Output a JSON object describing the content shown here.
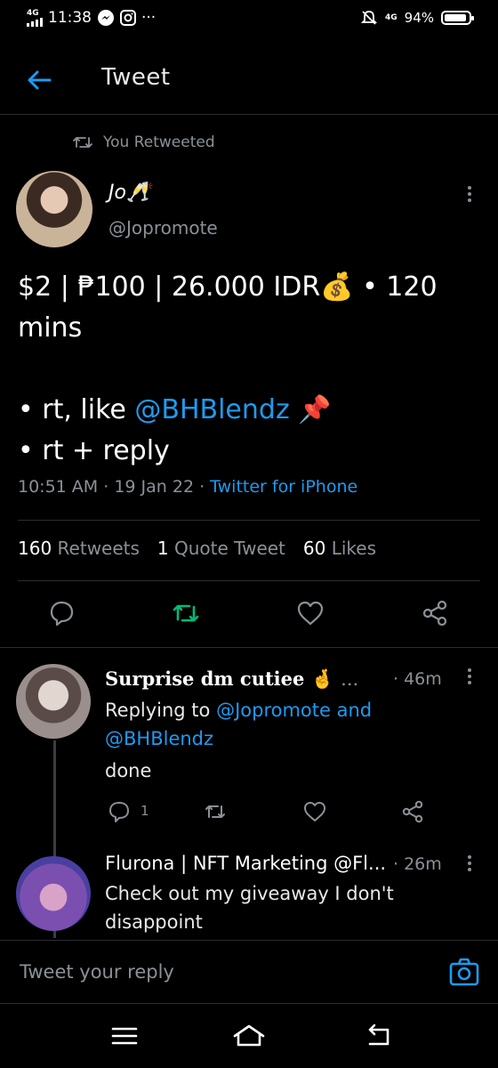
{
  "status_bar": {
    "network": "4G",
    "time": "11:38",
    "more": "···",
    "network_right": "4G",
    "battery": "94%",
    "battery_level": 0.94
  },
  "header": {
    "title": "Tweet"
  },
  "retweet_label": "You Retweeted",
  "author": {
    "name": "Jo🥂",
    "handle": "@Jopromote"
  },
  "tweet": {
    "line1": "$2 | ₱100 | 26.000 IDR💰 • 120 mins",
    "line2_prefix": "• rt, like ",
    "line2_mention": "@BHBlendz",
    "line2_suffix": " 📌",
    "line3": "• rt + reply"
  },
  "meta": {
    "time": "10:51 AM",
    "sep1": " · ",
    "date": "19 Jan 22",
    "sep2": " · ",
    "source": "Twitter for iPhone"
  },
  "stats": {
    "retweets_count": "160",
    "retweets_label": "Retweets",
    "quotes_count": "1",
    "quotes_label": "Quote Tweet",
    "likes_count": "60",
    "likes_label": "Likes"
  },
  "colors": {
    "accent": "#1d9bf0",
    "retweet_active": "#00ba7c",
    "background": "#000000",
    "muted": "#8b9197"
  },
  "replies": [
    {
      "name": "Surprise dm cutiee 🤞",
      "ellipsis": "...",
      "time": "· 46m",
      "replying_label": "Replying to ",
      "replying_to_1": "@Jopromote",
      "and": " and",
      "replying_to_2": "@BHBlendz",
      "text": "done",
      "reply_count": "1"
    },
    {
      "name": "Flurona | NFT Marketing @Fl...",
      "time": "· 26m",
      "text_line1": "Check out my giveaway I don't",
      "text_line2": "disappoint"
    }
  ],
  "compose": {
    "placeholder": "Tweet your reply"
  }
}
